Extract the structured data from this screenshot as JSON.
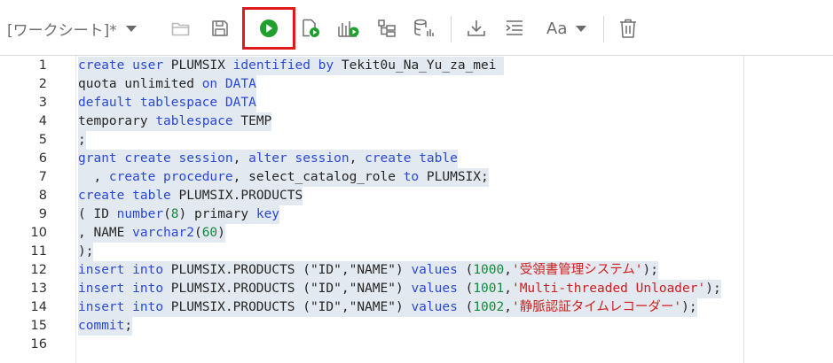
{
  "toolbar": {
    "worksheet_label": "[ワークシート]*",
    "font_button_label": "Aa"
  },
  "colors": {
    "run_button": "#1fa02c",
    "highlight_box": "#e01a1a",
    "keyword": "#2a49d6",
    "string": "#d01c1c",
    "number": "#138a3b",
    "selection": "#e3e9f1"
  },
  "icons": [
    "chevron-down-icon",
    "folder-open-icon",
    "save-icon",
    "run-statement-icon",
    "run-script-icon",
    "explain-plan-icon",
    "autotrace-icon",
    "sql-history-icon",
    "download-icon",
    "format-icon",
    "font-icon",
    "trash-icon"
  ],
  "editor": {
    "line_numbers": [
      "1",
      "2",
      "3",
      "4",
      "5",
      "6",
      "7",
      "8",
      "9",
      "10",
      "11",
      "12",
      "13",
      "14",
      "15",
      "16"
    ],
    "lines": [
      [
        [
          "kw",
          "create"
        ],
        [
          "p",
          " "
        ],
        [
          "kw",
          "user"
        ],
        [
          "p",
          " "
        ],
        [
          "id",
          "PLUMSIX"
        ],
        [
          "p",
          " "
        ],
        [
          "kw",
          "identified"
        ],
        [
          "p",
          " "
        ],
        [
          "kw",
          "by"
        ],
        [
          "p",
          " "
        ],
        [
          "id",
          "Tekit0u_Na_Yu_za_mei"
        ],
        [
          "p",
          " "
        ]
      ],
      [
        [
          "id",
          "quota"
        ],
        [
          "p",
          " "
        ],
        [
          "id",
          "unlimited"
        ],
        [
          "p",
          " "
        ],
        [
          "kw",
          "on"
        ],
        [
          "p",
          " "
        ],
        [
          "kw",
          "DATA"
        ]
      ],
      [
        [
          "kw",
          "default"
        ],
        [
          "p",
          " "
        ],
        [
          "kw",
          "tablespace"
        ],
        [
          "p",
          " "
        ],
        [
          "kw",
          "DATA"
        ]
      ],
      [
        [
          "id",
          "temporary"
        ],
        [
          "p",
          " "
        ],
        [
          "kw",
          "tablespace"
        ],
        [
          "p",
          " "
        ],
        [
          "id",
          "TEMP"
        ]
      ],
      [
        [
          "p",
          ";"
        ]
      ],
      [
        [
          "kw",
          "grant"
        ],
        [
          "p",
          " "
        ],
        [
          "kw",
          "create"
        ],
        [
          "p",
          " "
        ],
        [
          "kw",
          "session"
        ],
        [
          "p",
          ", "
        ],
        [
          "kw",
          "alter"
        ],
        [
          "p",
          " "
        ],
        [
          "kw",
          "session"
        ],
        [
          "p",
          ", "
        ],
        [
          "kw",
          "create"
        ],
        [
          "p",
          " "
        ],
        [
          "kw",
          "table"
        ]
      ],
      [
        [
          "p",
          "  , "
        ],
        [
          "kw",
          "create"
        ],
        [
          "p",
          " "
        ],
        [
          "kw",
          "procedure"
        ],
        [
          "p",
          ", "
        ],
        [
          "id",
          "select_catalog_role"
        ],
        [
          "p",
          " "
        ],
        [
          "kw",
          "to"
        ],
        [
          "p",
          " "
        ],
        [
          "id",
          "PLUMSIX"
        ],
        [
          "p",
          ";"
        ]
      ],
      [
        [
          "kw",
          "create"
        ],
        [
          "p",
          " "
        ],
        [
          "kw",
          "table"
        ],
        [
          "p",
          " "
        ],
        [
          "id",
          "PLUMSIX.PRODUCTS"
        ]
      ],
      [
        [
          "p",
          "( "
        ],
        [
          "id",
          "ID"
        ],
        [
          "p",
          " "
        ],
        [
          "kw",
          "number"
        ],
        [
          "p",
          "("
        ],
        [
          "num",
          "8"
        ],
        [
          "p",
          ") "
        ],
        [
          "id",
          "primary"
        ],
        [
          "p",
          " "
        ],
        [
          "kw",
          "key"
        ]
      ],
      [
        [
          "p",
          ", "
        ],
        [
          "id",
          "NAME"
        ],
        [
          "p",
          " "
        ],
        [
          "kw",
          "varchar2"
        ],
        [
          "p",
          "("
        ],
        [
          "num",
          "60"
        ],
        [
          "p",
          ")"
        ]
      ],
      [
        [
          "p",
          ");"
        ]
      ],
      [
        [
          "kw",
          "insert"
        ],
        [
          "p",
          " "
        ],
        [
          "kw",
          "into"
        ],
        [
          "p",
          " "
        ],
        [
          "id",
          "PLUMSIX.PRODUCTS"
        ],
        [
          "p",
          " ("
        ],
        [
          "id",
          "\"ID\""
        ],
        [
          "p",
          ","
        ],
        [
          "id",
          "\"NAME\""
        ],
        [
          "p",
          ") "
        ],
        [
          "kw",
          "values"
        ],
        [
          "p",
          " ("
        ],
        [
          "num",
          "1000"
        ],
        [
          "p",
          ","
        ],
        [
          "str",
          "'受領書管理システム'"
        ],
        [
          "p",
          ");"
        ]
      ],
      [
        [
          "kw",
          "insert"
        ],
        [
          "p",
          " "
        ],
        [
          "kw",
          "into"
        ],
        [
          "p",
          " "
        ],
        [
          "id",
          "PLUMSIX.PRODUCTS"
        ],
        [
          "p",
          " ("
        ],
        [
          "id",
          "\"ID\""
        ],
        [
          "p",
          ","
        ],
        [
          "id",
          "\"NAME\""
        ],
        [
          "p",
          ") "
        ],
        [
          "kw",
          "values"
        ],
        [
          "p",
          " ("
        ],
        [
          "num",
          "1001"
        ],
        [
          "p",
          ","
        ],
        [
          "str",
          "'Multi-threaded Unloader'"
        ],
        [
          "p",
          ");"
        ]
      ],
      [
        [
          "kw",
          "insert"
        ],
        [
          "p",
          " "
        ],
        [
          "kw",
          "into"
        ],
        [
          "p",
          " "
        ],
        [
          "id",
          "PLUMSIX.PRODUCTS"
        ],
        [
          "p",
          " ("
        ],
        [
          "id",
          "\"ID\""
        ],
        [
          "p",
          ","
        ],
        [
          "id",
          "\"NAME\""
        ],
        [
          "p",
          ") "
        ],
        [
          "kw",
          "values"
        ],
        [
          "p",
          " ("
        ],
        [
          "num",
          "1002"
        ],
        [
          "p",
          ","
        ],
        [
          "str",
          "'静脈認証タイムレコーダー'"
        ],
        [
          "p",
          ");"
        ]
      ],
      [
        [
          "kw",
          "commit"
        ],
        [
          "p",
          ";"
        ]
      ],
      []
    ]
  }
}
